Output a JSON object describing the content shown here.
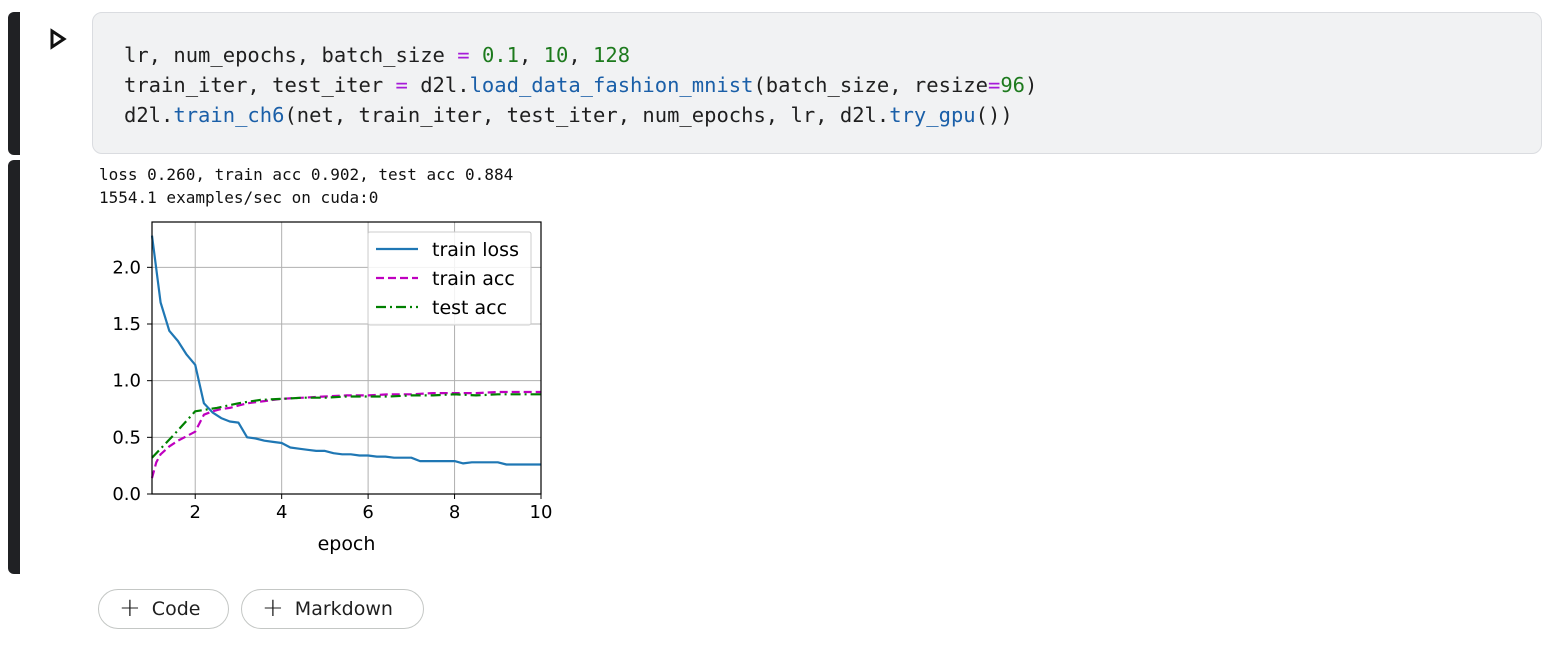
{
  "code_cell": {
    "run_button_icon": "play-icon",
    "lines": [
      [
        {
          "t": "lr, num_epochs, batch_size ",
          "c": "plain"
        },
        {
          "t": "=",
          "c": "op"
        },
        {
          "t": " ",
          "c": "plain"
        },
        {
          "t": "0.1",
          "c": "num"
        },
        {
          "t": ", ",
          "c": "plain"
        },
        {
          "t": "10",
          "c": "num"
        },
        {
          "t": ", ",
          "c": "plain"
        },
        {
          "t": "128",
          "c": "num"
        }
      ],
      [
        {
          "t": "train_iter, test_iter ",
          "c": "plain"
        },
        {
          "t": "=",
          "c": "op"
        },
        {
          "t": " d2l.",
          "c": "plain"
        },
        {
          "t": "load_data_fashion_mnist",
          "c": "fn"
        },
        {
          "t": "(batch_size, resize",
          "c": "plain"
        },
        {
          "t": "=",
          "c": "op"
        },
        {
          "t": "96",
          "c": "num"
        },
        {
          "t": ")",
          "c": "plain"
        }
      ],
      [
        {
          "t": "d2l.",
          "c": "plain"
        },
        {
          "t": "train_ch6",
          "c": "fn"
        },
        {
          "t": "(net, train_iter, test_iter, num_epochs, lr, d2l.",
          "c": "plain"
        },
        {
          "t": "try_gpu",
          "c": "fn"
        },
        {
          "t": "())",
          "c": "plain"
        }
      ]
    ]
  },
  "output": {
    "line1": "loss 0.260, train acc 0.902, test acc 0.884",
    "line2": "1554.1 examples/sec on cuda:0"
  },
  "chart_data": {
    "type": "line",
    "title": "",
    "xlabel": "epoch",
    "ylabel": "",
    "xlim": [
      1,
      10
    ],
    "ylim": [
      0,
      2.4
    ],
    "xticks": [
      "2",
      "4",
      "6",
      "8",
      "10"
    ],
    "yticks": [
      "0.0",
      "0.5",
      "1.0",
      "1.5",
      "2.0"
    ],
    "grid": true,
    "legend_position": "top-right",
    "series": [
      {
        "name": "train loss",
        "color": "#1f77b4",
        "style": "solid",
        "x": [
          1.0,
          1.2,
          1.4,
          1.6,
          1.8,
          2.0,
          2.2,
          2.4,
          2.6,
          2.8,
          3.0,
          3.2,
          3.4,
          3.6,
          3.8,
          4.0,
          4.2,
          4.4,
          4.6,
          4.8,
          5.0,
          5.2,
          5.4,
          5.6,
          5.8,
          6.0,
          6.2,
          6.4,
          6.6,
          6.8,
          7.0,
          7.2,
          7.4,
          7.6,
          7.8,
          8.0,
          8.2,
          8.4,
          8.6,
          8.8,
          9.0,
          9.2,
          9.4,
          9.6,
          9.8,
          10.0
        ],
        "y": [
          2.28,
          1.69,
          1.44,
          1.35,
          1.23,
          1.14,
          0.8,
          0.72,
          0.67,
          0.64,
          0.63,
          0.5,
          0.49,
          0.47,
          0.46,
          0.45,
          0.41,
          0.4,
          0.39,
          0.38,
          0.38,
          0.36,
          0.35,
          0.35,
          0.34,
          0.34,
          0.33,
          0.33,
          0.32,
          0.32,
          0.32,
          0.29,
          0.29,
          0.29,
          0.29,
          0.29,
          0.27,
          0.28,
          0.28,
          0.28,
          0.28,
          0.26,
          0.26,
          0.26,
          0.26,
          0.26
        ]
      },
      {
        "name": "train acc",
        "color": "#bf00bf",
        "style": "dashed",
        "x": [
          1.0,
          1.1,
          1.2,
          1.4,
          1.6,
          1.8,
          2.0,
          2.2,
          2.4,
          2.6,
          2.8,
          3.0,
          3.2,
          3.6,
          4.0,
          4.5,
          5.0,
          5.5,
          6.0,
          6.5,
          7.0,
          7.5,
          8.0,
          8.5,
          9.0,
          9.5,
          10.0
        ],
        "y": [
          0.14,
          0.28,
          0.35,
          0.42,
          0.47,
          0.51,
          0.55,
          0.7,
          0.73,
          0.75,
          0.76,
          0.78,
          0.8,
          0.82,
          0.84,
          0.85,
          0.86,
          0.87,
          0.87,
          0.88,
          0.88,
          0.89,
          0.89,
          0.89,
          0.9,
          0.9,
          0.9
        ]
      },
      {
        "name": "test acc",
        "color": "#008000",
        "style": "dashdot",
        "x": [
          1.0,
          1.5,
          2.0,
          2.5,
          3.0,
          3.5,
          4.0,
          4.5,
          5.0,
          5.5,
          6.0,
          6.5,
          7.0,
          7.5,
          8.0,
          8.5,
          9.0,
          9.5,
          10.0
        ],
        "y": [
          0.32,
          0.52,
          0.73,
          0.76,
          0.8,
          0.83,
          0.84,
          0.85,
          0.85,
          0.86,
          0.86,
          0.86,
          0.87,
          0.87,
          0.88,
          0.87,
          0.88,
          0.88,
          0.88
        ]
      }
    ]
  },
  "toolbar": {
    "add_code_label": "Code",
    "add_markdown_label": "Markdown"
  }
}
